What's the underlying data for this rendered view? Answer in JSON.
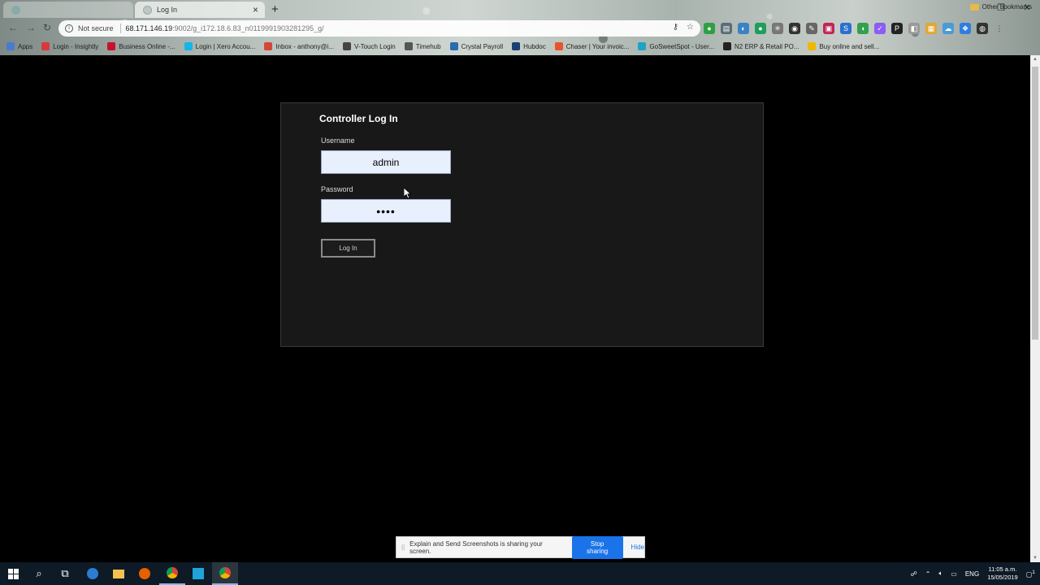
{
  "browser": {
    "tabs": [
      {
        "title": "",
        "active": false
      },
      {
        "title": "Log In",
        "active": true
      }
    ],
    "new_tab_label": "+",
    "window_controls": {
      "minimize": "—",
      "restore": "❐",
      "close": "✕"
    },
    "nav": {
      "back": "←",
      "forward": "→",
      "reload": "↻"
    },
    "address": {
      "security_label": "Not secure",
      "url_host": "68.171.146.19",
      "url_path": ":9002/g_i172.18.6.83_n0119991903281295_g/"
    },
    "bookmarks": [
      {
        "label": "Apps",
        "color": "#4a7bd1"
      },
      {
        "label": "Login - Insightly",
        "color": "#d83a3a"
      },
      {
        "label": "Business Online -...",
        "color": "#c8102e"
      },
      {
        "label": "Login | Xero Accou...",
        "color": "#13b5ea"
      },
      {
        "label": "Inbox - anthony@i...",
        "color": "#d44638"
      },
      {
        "label": "V-Touch Login",
        "color": "#444444"
      },
      {
        "label": "Timehub",
        "color": "#555555"
      },
      {
        "label": "Crystal Payroll",
        "color": "#2b6cb0"
      },
      {
        "label": "Hubdoc",
        "color": "#1d3f72"
      },
      {
        "label": "Chaser | Your invoic...",
        "color": "#e8542e"
      },
      {
        "label": "GoSweetSpot - User...",
        "color": "#1fa3c4"
      },
      {
        "label": "N2 ERP & Retail PO...",
        "color": "#222222"
      },
      {
        "label": "Buy online and sell...",
        "color": "#f2b705"
      }
    ],
    "other_bookmarks": "Other bookmarks"
  },
  "login": {
    "title": "Controller Log In",
    "username_label": "Username",
    "username_value": "admin",
    "password_label": "Password",
    "password_value": "••••",
    "submit_label": "Log In"
  },
  "sharing": {
    "message": "Explain and Send Screenshots is sharing your screen.",
    "stop_label": "Stop sharing",
    "hide_label": "Hide"
  },
  "taskbar": {
    "language": "ENG",
    "time": "11:05 a.m.",
    "date": "15/05/2019",
    "notifications": "1"
  }
}
